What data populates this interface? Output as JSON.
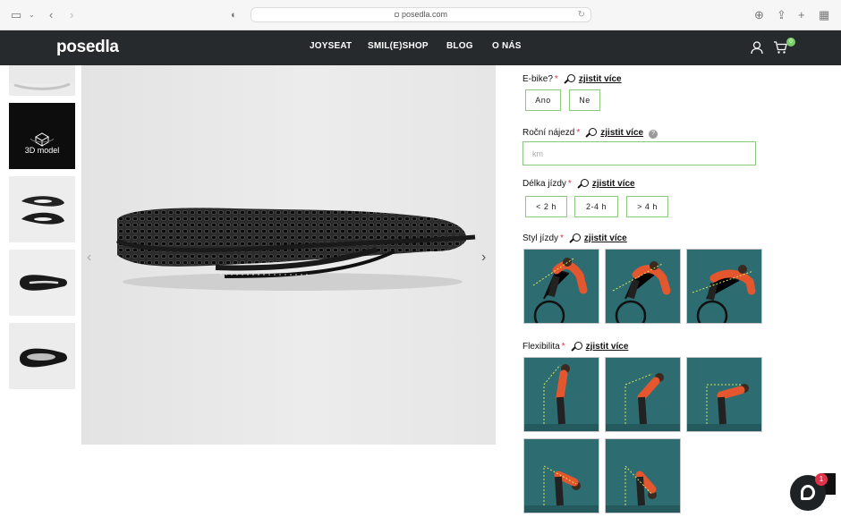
{
  "browser": {
    "url": "posedla.com"
  },
  "nav": {
    "logo": "posedla",
    "items": [
      "JOYSEAT",
      "SMIL(E)SHOP",
      "BLOG",
      "O NÁS"
    ],
    "cart_count": "0"
  },
  "gallery": {
    "thumb_3d_label": "3D model"
  },
  "form": {
    "more_link": "zjistit více",
    "required_mark": "*",
    "ebike": {
      "label": "E-bike?",
      "options": [
        "Ano",
        "Ne"
      ]
    },
    "annual": {
      "label": "Roční nájezd",
      "placeholder": "km",
      "help": "?"
    },
    "duration": {
      "label": "Délka jízdy",
      "options": [
        "< 2 h",
        "2-4 h",
        "> 4 h"
      ]
    },
    "style": {
      "label": "Styl jízdy"
    },
    "flex": {
      "label": "Flexibilita"
    }
  },
  "chat": {
    "badge": "1"
  },
  "colors": {
    "nav_bg": "#262a2c",
    "accent_green": "#8cc97e",
    "required_red": "#e0334a",
    "tile_bg": "#2d6c70"
  }
}
